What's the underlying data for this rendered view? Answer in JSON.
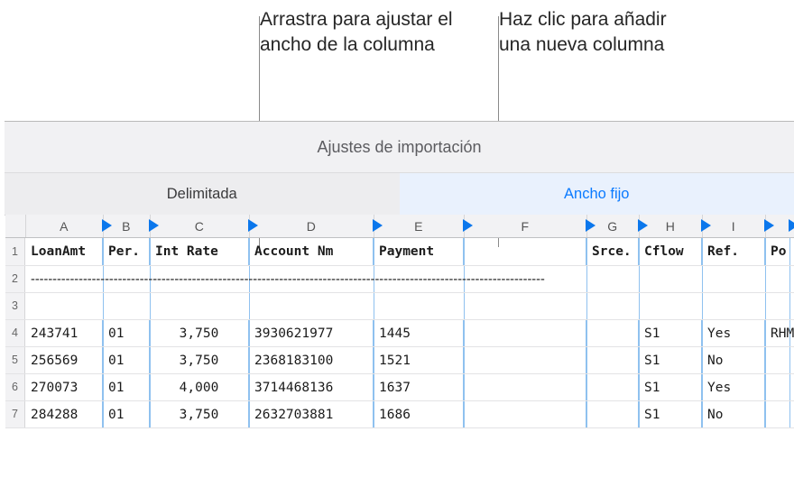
{
  "annotations": {
    "resize": "Arrastra para ajustar el ancho de la columna",
    "add": "Haz clic para añadir una nueva columna"
  },
  "panel": {
    "title": "Ajustes de importación",
    "tabs": {
      "delimited": "Delimitada",
      "fixed": "Ancho fijo"
    }
  },
  "columns": {
    "letters": [
      "A",
      "B",
      "C",
      "D",
      "E",
      "F",
      "G",
      "H",
      "I"
    ],
    "headers": [
      "LoanAmt",
      "Per.",
      "Int Rate",
      "Account Nm",
      "Payment",
      "",
      "Srce.",
      "Cflow",
      "Ref.",
      "Po"
    ]
  },
  "rownums": [
    "1",
    "2",
    "3",
    "4",
    "5",
    "6",
    "7"
  ],
  "dashrow": "----------------------------------------------------------------------------------------------------------------------",
  "data": [
    {
      "a": "243741",
      "b": "01",
      "c": "3,750",
      "d": "3930621977",
      "e": "1445",
      "f": "",
      "g": "",
      "h": "S1",
      "i": "Yes",
      "j": "RHMXWPO"
    },
    {
      "a": "256569",
      "b": "01",
      "c": "3,750",
      "d": "2368183100",
      "e": "1521",
      "f": "",
      "g": "",
      "h": "S1",
      "i": "No",
      "j": ""
    },
    {
      "a": "270073",
      "b": "01",
      "c": "4,000",
      "d": "3714468136",
      "e": "1637",
      "f": "",
      "g": "",
      "h": "S1",
      "i": "Yes",
      "j": ""
    },
    {
      "a": "284288",
      "b": "01",
      "c": "3,750",
      "d": "2632703881",
      "e": "1686",
      "f": "",
      "g": "",
      "h": "S1",
      "i": "No",
      "j": ""
    }
  ]
}
